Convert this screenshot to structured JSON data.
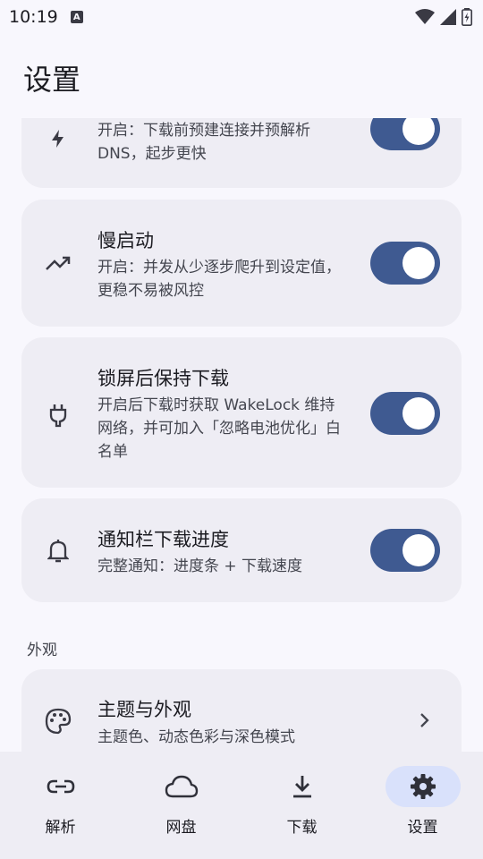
{
  "status_bar": {
    "time": "10:19",
    "notification_glyph": "A"
  },
  "page": {
    "title": "设置"
  },
  "settings": {
    "preconnect": {
      "desc": "开启：下载前预建连接并预解析\nDNS，起步更快",
      "enabled": true
    },
    "slow_start": {
      "title": "慢启动",
      "desc": "开启：并发从少逐步爬升到设定值，\n更稳不易被风控",
      "enabled": true
    },
    "wakelock": {
      "title": "锁屏后保持下载",
      "desc": "开启后下载时获取 WakeLock 维持\n网络，并可加入「忽略电池优化」白\n名单",
      "enabled": true
    },
    "notify_progress": {
      "title": "通知栏下载进度",
      "desc": "完整通知：进度条 + 下载速度",
      "enabled": true
    }
  },
  "sections": {
    "appearance": "外观"
  },
  "theme": {
    "title": "主题与外观",
    "desc": "主题色、动态色彩与深色模式"
  },
  "bottom_nav": {
    "items": [
      {
        "label": "解析",
        "icon": "link-icon"
      },
      {
        "label": "网盘",
        "icon": "cloud-icon"
      },
      {
        "label": "下载",
        "icon": "download-icon"
      },
      {
        "label": "设置",
        "icon": "gear-icon",
        "active": true
      }
    ]
  },
  "colors": {
    "accent": "#3f5a91",
    "card": "#eeedf4",
    "background": "#f8f7fd",
    "nav_active": "#d9e1fb"
  }
}
